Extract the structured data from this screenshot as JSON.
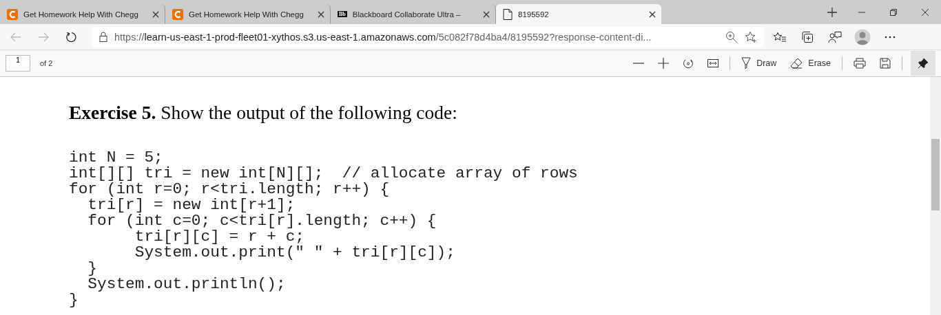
{
  "tabs": [
    {
      "kind": "chegg",
      "title": "Get Homework Help With Chegg",
      "selected": false
    },
    {
      "kind": "chegg",
      "title": "Get Homework Help With Chegg",
      "selected": false
    },
    {
      "kind": "blackboard",
      "logo": "Bb",
      "title": "Blackboard Collaborate Ultra –",
      "selected": false
    },
    {
      "kind": "document",
      "title": "8195592",
      "selected": true
    }
  ],
  "address_bar": {
    "origin": "https://",
    "host": "learn-us-east-1-prod-fleet01-xythos.s3.us-east-1.amazonaws.com",
    "path": "/5c082f78d4ba4/8195592?response-content-di..."
  },
  "pdf_toolbar": {
    "page": "1",
    "page_count": "of 2",
    "draw": "Draw",
    "erase": "Erase",
    "pinned": true
  },
  "document": {
    "heading": "**Exercise 5.** Show the output of the following code:",
    "code": [
      "int N = 5;",
      "int[][] tri = new int[N][];  // allocate array of rows",
      "for (int r=0; r<tri.length; r++) {",
      "  tri[r] = new int[r+1];",
      "  for (int c=0; c<tri[r].length; c++) {",
      "       tri[r][c] = r + c;",
      "       System.out.print(\" \" + tri[r][c]);",
      "  }",
      "  System.out.println();",
      "}"
    ]
  }
}
